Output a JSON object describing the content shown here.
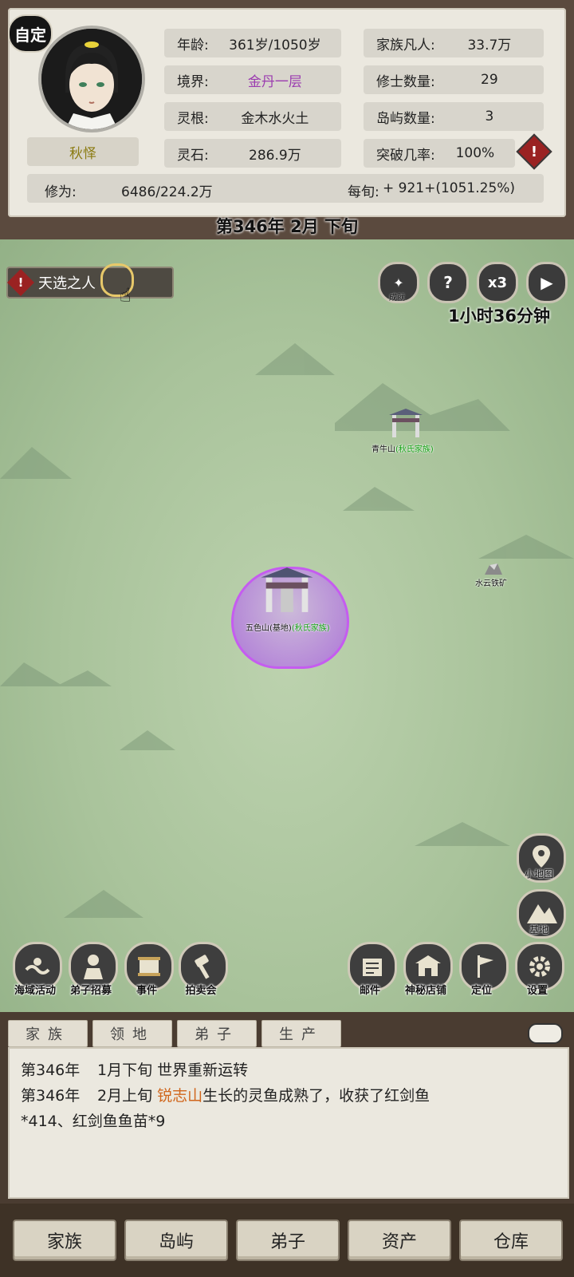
{
  "header": {
    "auto_badge": "自定",
    "character_name": "秋怿",
    "stats": [
      {
        "label": "年龄:",
        "value": "361岁/1050岁"
      },
      {
        "label": "境界:",
        "value": "金丹一层"
      },
      {
        "label": "灵根:",
        "value": "金木水火土"
      },
      {
        "label": "灵石:",
        "value": "286.9万"
      },
      {
        "label": "家族凡人:",
        "value": "33.7万"
      },
      {
        "label": "修士数量:",
        "value": "29"
      },
      {
        "label": "岛屿数量:",
        "value": "3"
      },
      {
        "label": "突破几率:",
        "value": "100%"
      }
    ],
    "cultivation_label": "修为:",
    "cultivation_value": "6486/224.2万",
    "per_turn_label": "每旬:",
    "per_turn_value": "+ 921+(1051.25%)",
    "warning_glyph": "!",
    "realm_color": "#9b3cb0"
  },
  "date": "第346年 2月 下旬",
  "map": {
    "quest": {
      "icon": "!",
      "label": "天选之人"
    },
    "top_buttons": [
      {
        "name": "achievement",
        "glyph": "✦",
        "label": "成就"
      },
      {
        "name": "help",
        "glyph": "?"
      },
      {
        "name": "speed",
        "glyph": "x3"
      },
      {
        "name": "play",
        "glyph": "▶"
      }
    ],
    "timer": "1小时36分钟",
    "locations": [
      {
        "name": "青牛山",
        "clan": "(秋氏家族)"
      },
      {
        "name": "水云铁矿",
        "clan": ""
      },
      {
        "name": "五色山(基地)",
        "clan": "(秋氏家族)"
      }
    ],
    "side_buttons": [
      {
        "label": "小地图"
      },
      {
        "label": "基地"
      }
    ],
    "dock_left": [
      {
        "label": "海域活动"
      },
      {
        "label": "弟子招募"
      },
      {
        "label": "事件"
      },
      {
        "label": "拍卖会"
      }
    ],
    "dock_right": [
      {
        "label": "邮件"
      },
      {
        "label": "神秘店铺"
      },
      {
        "label": "定位"
      },
      {
        "label": "设置"
      }
    ]
  },
  "log": {
    "tabs": [
      "家族",
      "领地",
      "弟子",
      "生产"
    ],
    "entries": [
      {
        "year": "第346年",
        "pre": "1月下旬 世界重新运转",
        "highlight": "",
        "post": ""
      },
      {
        "year": "第346年",
        "pre": "2月上旬 ",
        "highlight": "锐志山",
        "post": "生长的灵鱼成熟了，收获了红剑鱼",
        "line2": "*414、红剑鱼鱼苗*9"
      }
    ]
  },
  "bottom_nav": [
    "家族",
    "岛屿",
    "弟子",
    "资产",
    "仓库"
  ]
}
